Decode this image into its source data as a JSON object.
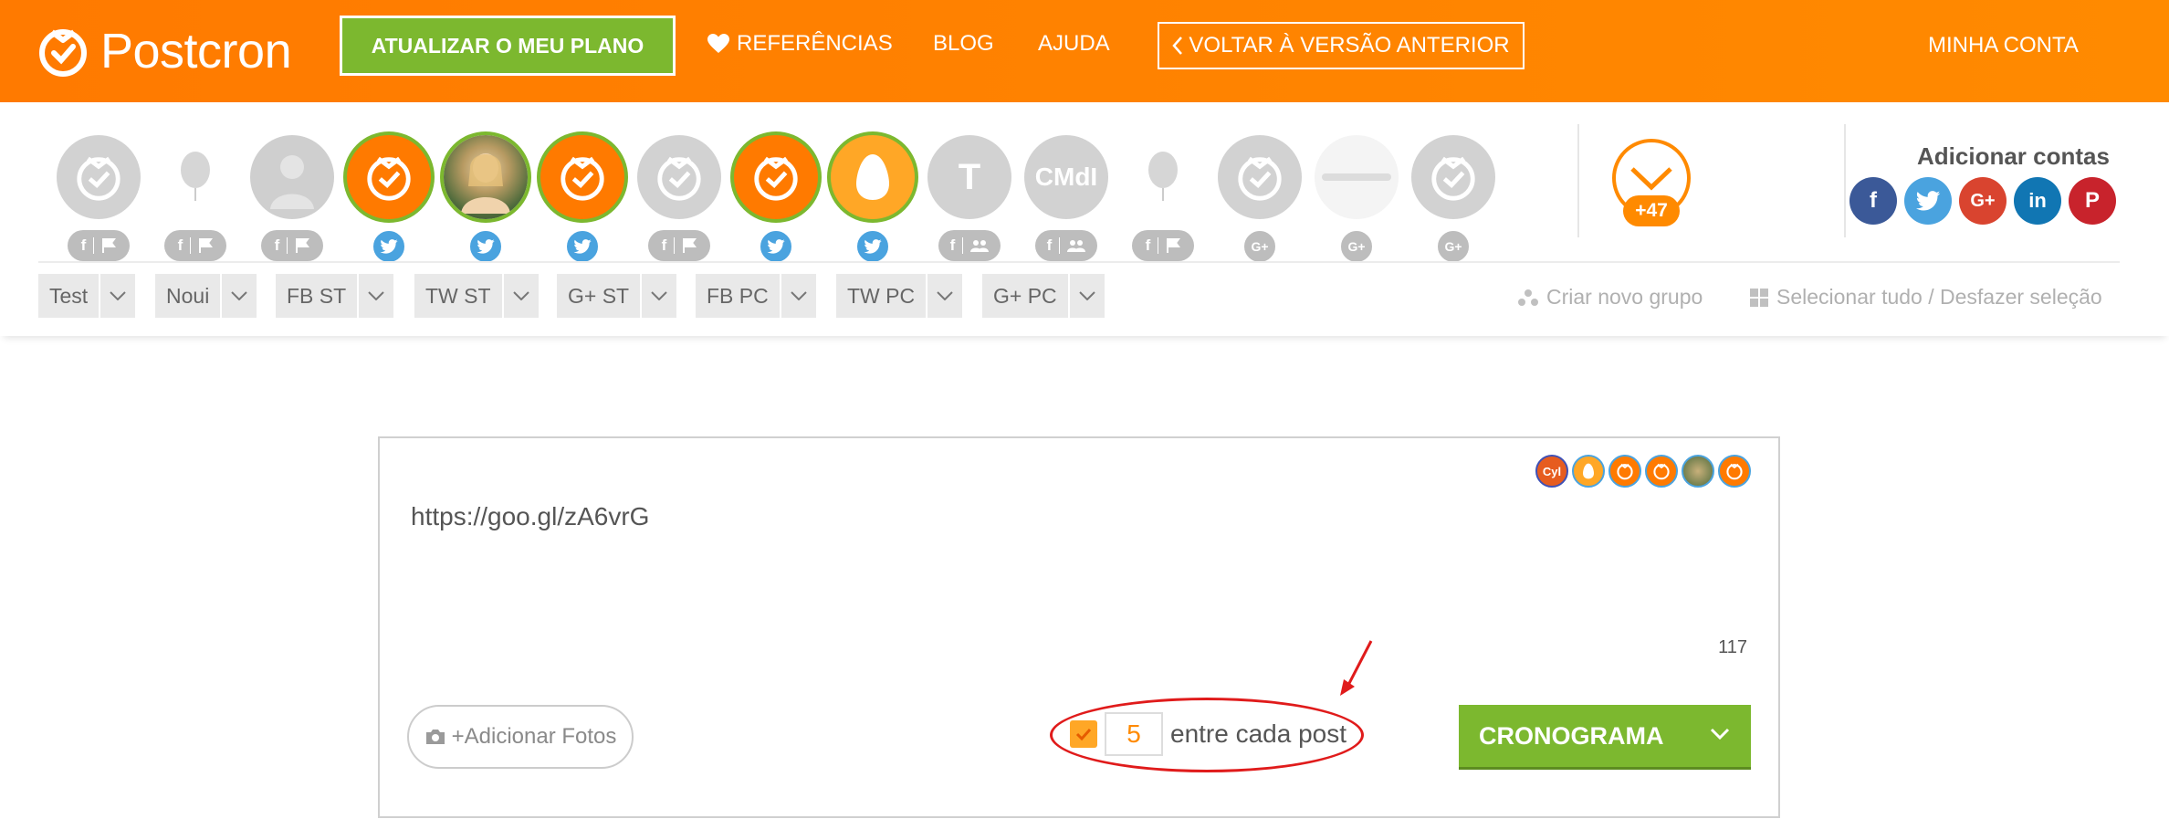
{
  "header": {
    "logo_text": "Postcron",
    "upgrade_label": "ATUALIZAR O MEU PLANO",
    "nav_references": "REFERÊNCIAS",
    "nav_blog": "BLOG",
    "nav_help": "AJUDA",
    "back_label": "VOLTAR À VERSÃO ANTERIOR",
    "account_label": "MINHA CONTA"
  },
  "accounts": {
    "items": [
      {
        "type": "postcron-gray",
        "badge": "fb-page"
      },
      {
        "type": "balloon",
        "badge": "fb-page"
      },
      {
        "type": "person-gray",
        "badge": "fb-page"
      },
      {
        "type": "postcron-orange",
        "badge": "twitter"
      },
      {
        "type": "photo",
        "badge": "twitter"
      },
      {
        "type": "postcron-orange",
        "badge": "twitter"
      },
      {
        "type": "postcron-gray",
        "badge": "fb-page"
      },
      {
        "type": "postcron-orange",
        "badge": "twitter"
      },
      {
        "type": "egg",
        "badge": "twitter"
      },
      {
        "type": "letter",
        "letter": "T",
        "badge": "fb-group"
      },
      {
        "type": "letter",
        "letter": "CMdI",
        "badge": "fb-group"
      },
      {
        "type": "balloon",
        "badge": "fb-page"
      },
      {
        "type": "postcron-gray",
        "badge": "gplus"
      },
      {
        "type": "postcron-white",
        "badge": "gplus"
      },
      {
        "type": "postcron-gray",
        "badge": "gplus"
      }
    ],
    "more_count": "+47",
    "add_title": "Adicionar contas"
  },
  "groups": [
    {
      "label": "Test"
    },
    {
      "label": "Noui"
    },
    {
      "label": "FB ST"
    },
    {
      "label": "TW ST"
    },
    {
      "label": "G+ ST"
    },
    {
      "label": "FB PC"
    },
    {
      "label": "TW PC"
    },
    {
      "label": "G+ PC"
    }
  ],
  "group_tools": {
    "create_group": "Criar novo grupo",
    "select_all": "Selecionar tudo / Desfazer seleção"
  },
  "composer": {
    "text": "https://goo.gl/zA6vrG",
    "char_count": "117",
    "add_photos": "+Adicionar Fotos",
    "interval_value": "5",
    "interval_label": "entre cada post",
    "schedule_label": "CRONOGRAMA",
    "mini_avatar_cyl": "Cyl"
  },
  "colors": {
    "brand_orange": "#ff7a00",
    "accent_green": "#7cb82f",
    "twitter_blue": "#4aa3df",
    "highlight_red": "#e01b1b"
  }
}
